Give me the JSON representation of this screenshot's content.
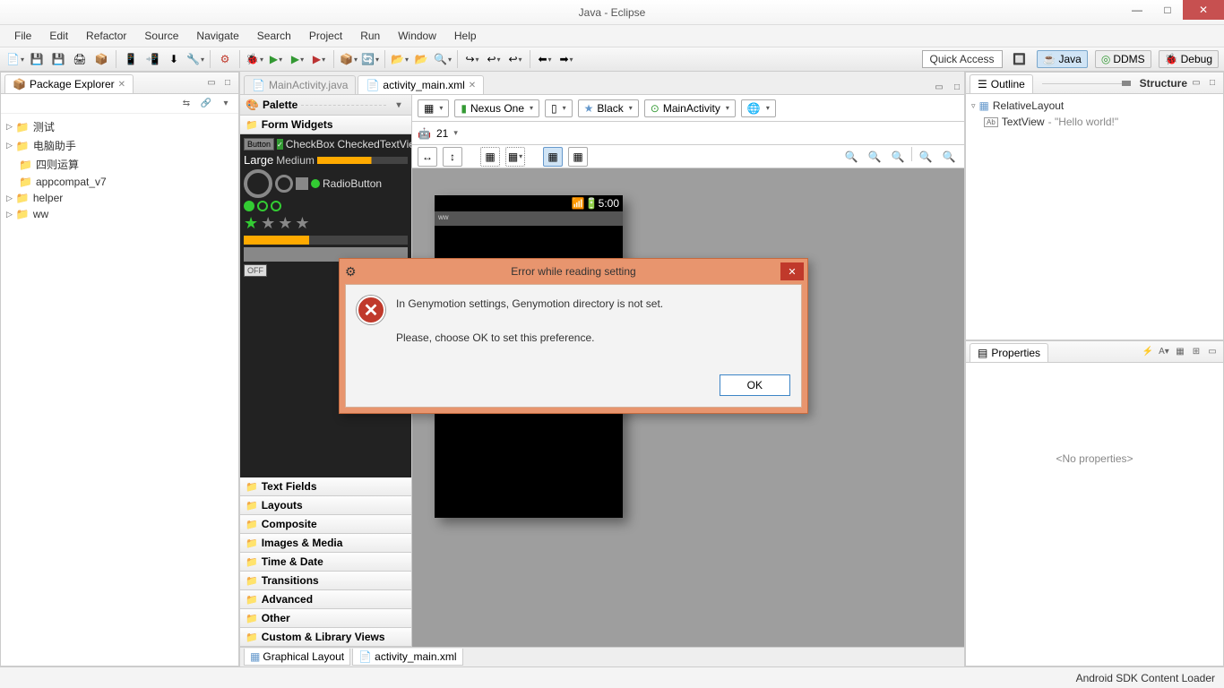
{
  "window": {
    "title": "Java - Eclipse"
  },
  "menu": [
    "File",
    "Edit",
    "Refactor",
    "Source",
    "Navigate",
    "Search",
    "Project",
    "Run",
    "Window",
    "Help"
  ],
  "quick_access": "Quick Access",
  "perspectives": {
    "java": "Java",
    "ddms": "DDMS",
    "debug": "Debug"
  },
  "pkg_explorer": {
    "title": "Package Explorer",
    "items": [
      "测试",
      "电脑助手",
      "四则运算",
      "appcompat_v7",
      "helper",
      "ww"
    ]
  },
  "editor_tabs": {
    "inactive": "MainActivity.java",
    "active": "activity_main.xml"
  },
  "palette": {
    "title": "Palette",
    "form_widgets": "Form Widgets",
    "button": "Button",
    "checkbox": "CheckBox",
    "checkedtext": "CheckedTextView",
    "large": "Large",
    "medium": "Medium",
    "radio": "RadioButton",
    "off": "OFF",
    "sections": [
      "Text Fields",
      "Layouts",
      "Composite",
      "Images & Media",
      "Time & Date",
      "Transitions",
      "Advanced",
      "Other",
      "Custom & Library Views"
    ]
  },
  "canvas": {
    "device": "Nexus One",
    "theme": "Black",
    "activity": "MainActivity",
    "api": "21",
    "status_time": "5:00",
    "app_name": "ww"
  },
  "bottom_tabs": {
    "graphical": "Graphical Layout",
    "xml": "activity_main.xml"
  },
  "outline": {
    "title": "Outline",
    "structure": "Structure",
    "root": "RelativeLayout",
    "child": "TextView",
    "child_text": "- \"Hello world!\""
  },
  "properties": {
    "title": "Properties",
    "empty": "<No properties>"
  },
  "dialog": {
    "title": "Error while reading setting",
    "line1": "In Genymotion settings, Genymotion directory is not set.",
    "line2": "Please, choose OK to set this preference.",
    "ok": "OK"
  },
  "status_bar": "Android SDK Content Loader"
}
